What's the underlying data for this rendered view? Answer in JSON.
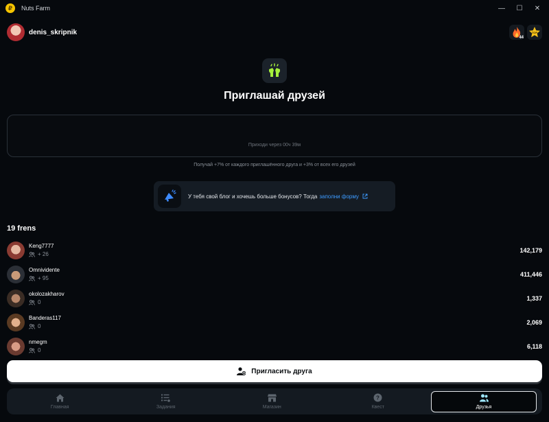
{
  "window": {
    "title": "Nuts Farm",
    "logo": "₽"
  },
  "header": {
    "username": "denis_skripnik",
    "streak": "44",
    "top_label": "TOP"
  },
  "page": {
    "title": "Приглашай друзей",
    "countdown": "Приходи через 00ч 39м",
    "bonus_info": "Получай +7% от каждого приглашённого друга и +3% от всех его друзей"
  },
  "banner": {
    "text": "У тебя свой блог и хочешь больше бонусов? Тогда",
    "link": "заполни форму"
  },
  "frens": {
    "title": "19 frens",
    "items": [
      {
        "name": "Keng7777",
        "count": "+ 26",
        "score": "142,179"
      },
      {
        "name": "Omnividente",
        "count": "+ 95",
        "score": "411,446"
      },
      {
        "name": "okolozakharov",
        "count": "0",
        "score": "1,337"
      },
      {
        "name": "Banderas117",
        "count": "0",
        "score": "2,069"
      },
      {
        "name": "nmegm",
        "count": "0",
        "score": "6,118"
      }
    ]
  },
  "invite_button": "Пригласить друга",
  "nav": [
    "Главная",
    "Задания",
    "Магазин",
    "Квест",
    "Друзья"
  ],
  "colors": {
    "accent": "#a6f03c",
    "link": "#3d9bff",
    "background": "#06090d"
  }
}
